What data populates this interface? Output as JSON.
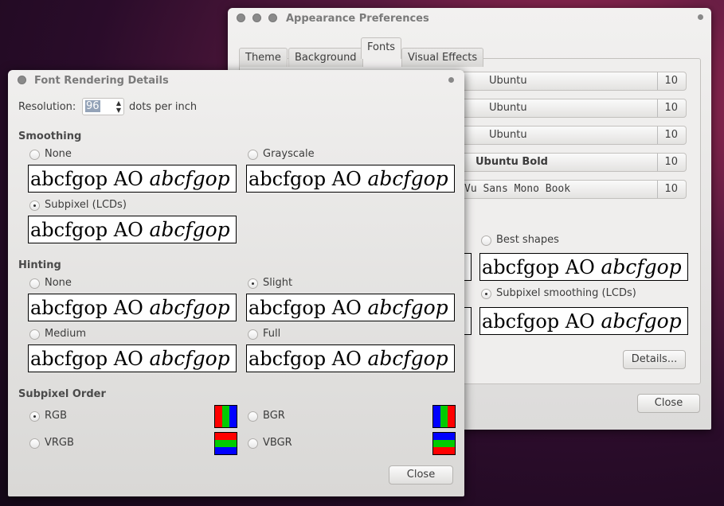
{
  "appearance": {
    "title": "Appearance Preferences",
    "tabs": [
      "Theme",
      "Background",
      "Fonts",
      "Visual Effects"
    ],
    "active_tab": "Fonts",
    "fonts": [
      {
        "name": "Ubuntu",
        "size": "10"
      },
      {
        "name": "Ubuntu",
        "size": "10"
      },
      {
        "name": "Ubuntu",
        "size": "10"
      },
      {
        "name": "Ubuntu Bold",
        "size": "10"
      },
      {
        "name": "Vu Sans Mono Book",
        "size": "10"
      }
    ],
    "rendering": [
      {
        "label": "Best shapes",
        "selected": false
      },
      {
        "label": "Subpixel smoothing (LCDs)",
        "selected": true
      }
    ],
    "sample_regular": "abcfgop AO ",
    "sample_italic": "abcfgop",
    "details_label": "Details...",
    "close_label": "Close"
  },
  "details": {
    "title": "Font Rendering Details",
    "resolution_label": "Resolution:",
    "resolution_value": "96",
    "resolution_unit": "dots per inch",
    "smoothing_heading": "Smoothing",
    "smoothing": [
      {
        "label": "None",
        "selected": false
      },
      {
        "label": "Grayscale",
        "selected": false
      },
      {
        "label": "Subpixel (LCDs)",
        "selected": true
      }
    ],
    "hinting_heading": "Hinting",
    "hinting": [
      {
        "label": "None",
        "selected": false
      },
      {
        "label": "Slight",
        "selected": true
      },
      {
        "label": "Medium",
        "selected": false
      },
      {
        "label": "Full",
        "selected": false
      }
    ],
    "order_heading": "Subpixel Order",
    "order": [
      {
        "label": "RGB",
        "selected": true
      },
      {
        "label": "BGR",
        "selected": false
      },
      {
        "label": "VRGB",
        "selected": false
      },
      {
        "label": "VBGR",
        "selected": false
      }
    ],
    "sample_regular": "abcfgop AO ",
    "sample_italic": "abcfgop",
    "close_label": "Close"
  },
  "colors": {
    "red": "#ff0000",
    "green": "#00c000",
    "blue": "#0000ff"
  }
}
